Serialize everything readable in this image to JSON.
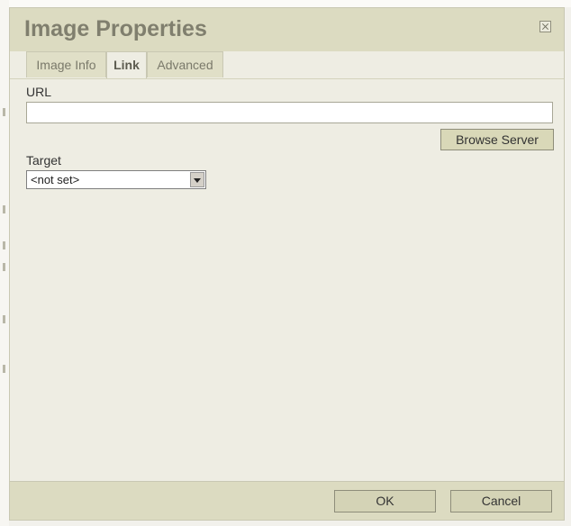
{
  "dialog": {
    "title": "Image Properties"
  },
  "tabs": [
    {
      "label": "Image Info",
      "active": false
    },
    {
      "label": "Link",
      "active": true
    },
    {
      "label": "Advanced",
      "active": false
    }
  ],
  "link": {
    "url_label": "URL",
    "url_value": "",
    "browse_label": "Browse Server",
    "target_label": "Target",
    "target_selected": "<not set>"
  },
  "footer": {
    "ok_label": "OK",
    "cancel_label": "Cancel"
  },
  "icons": {
    "close": "close-icon",
    "dropdown": "chevron-down-icon"
  },
  "colors": {
    "title_bar": "#dcdbc1",
    "panel": "#eeede3",
    "button": "#d4d3b6"
  }
}
